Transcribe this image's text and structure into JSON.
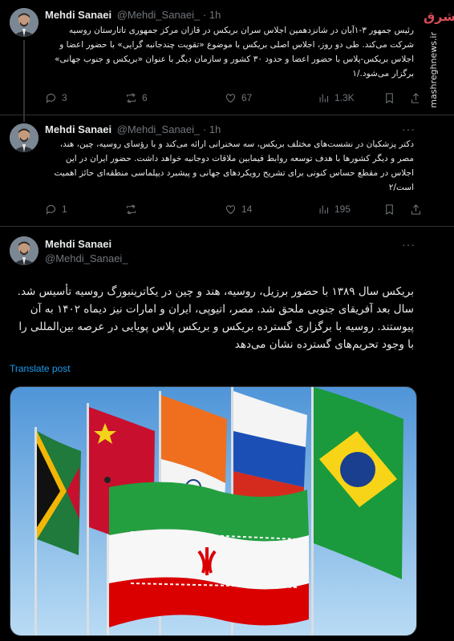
{
  "watermark": {
    "site": "mashreghnews.ir",
    "logo_text": "مشرق"
  },
  "tweets": [
    {
      "author": "Mehdi Sanaei",
      "handle": "@Mehdi_Sanaei_",
      "separator": "·",
      "time": "1h",
      "more": "···",
      "text": "رئیس جمهور ۳-۱آبان در شانزدهمین اجلاس سران بریکس در قازان مرکز جمهوری تاتارستان روسیه شرکت می‌کند. طی دو روز، اجلاس اصلی بریکس با موضوع «تقویت چندجانبه گرایی» با حضور اعضا و اجلاس بریکس-پلاس با حضور اعضا و حدود ۳۰ کشور و سازمان دیگر با عنوان «بریکس و جنوب جهانی» برگزار می‌شود./۱",
      "stats": {
        "replies": "3",
        "reposts": "6",
        "likes": "67",
        "views": "1.3K"
      }
    },
    {
      "author": "Mehdi Sanaei",
      "handle": "@Mehdi_Sanaei_",
      "separator": "·",
      "time": "1h",
      "more": "···",
      "text": "دکتر پزشکیان در نشست‌های مختلف بریکس، سه سخنرانی ارائه می‌کند و با رؤسای روسیه، چین، هند، مصر و دیگر کشورها با هدف توسعه روابط فیمابین ملاقات دوجانبه خواهد داشت. حضور ایران در این اجلاس در مقطع حساس کنونی برای تشریح رویکردهای جهانی و پیشبرد دیپلماسی منطقه‌ای حائز اهمیت است/۲",
      "stats": {
        "replies": "1",
        "reposts": "",
        "likes": "14",
        "views": "195"
      }
    },
    {
      "author": "Mehdi Sanaei",
      "handle": "@Mehdi_Sanaei_",
      "more": "···",
      "text": "بریکس سال ۱۳۸۹ با حضور برزیل، روسیه، هند و چین در یکاترینبورگ روسیه تأسیس شد. سال بعد آفریقای جنوبی ملحق شد. مصر، اتیوپی، ایران و امارات نیز دیماه ۱۴۰۲ به آن پیوستند. روسیه با برگزاری گسترده بریکس و بریکس پلاس پویایی در عرصه بین‌المللی را با وجود تحریم‌های گسترده نشان می‌دهد",
      "translate": "Translate post"
    }
  ]
}
